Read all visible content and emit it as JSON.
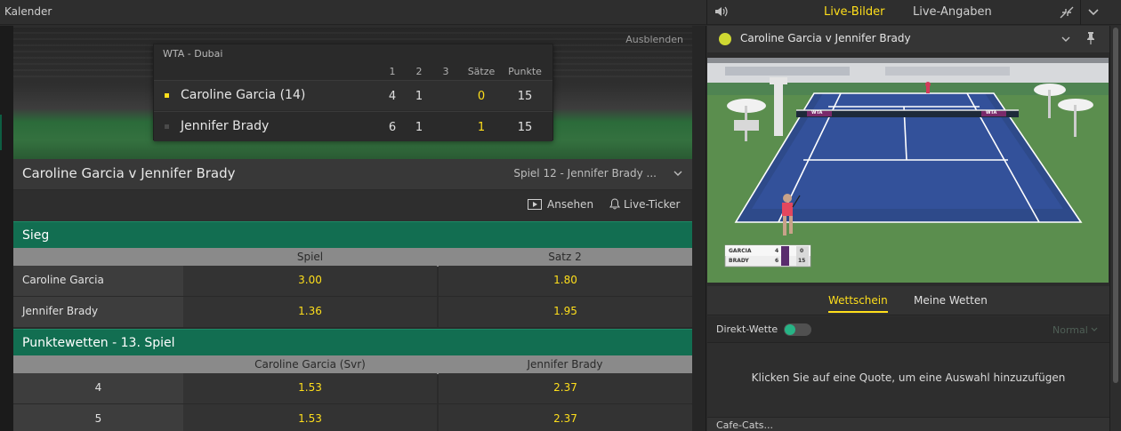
{
  "topbar": {
    "calendar": "Kalender",
    "tabs": [
      "Live-Bilder",
      "Live-Angaben"
    ]
  },
  "hero": {
    "hide_label": "Ausblenden",
    "scoreboard": {
      "tournament": "WTA - Dubai",
      "headers": [
        "1",
        "2",
        "3",
        "Sätze",
        "Punkte"
      ],
      "players": [
        {
          "name": "Caroline Garcia (14)",
          "set1": "4",
          "set2": "1",
          "set3": "",
          "sets": "0",
          "points": "15",
          "serving": true
        },
        {
          "name": "Jennifer Brady",
          "set1": "6",
          "set2": "1",
          "set3": "",
          "sets": "1",
          "points": "15",
          "serving": false
        }
      ]
    }
  },
  "match": {
    "title": "Caroline Garcia v Jennifer Brady",
    "game_status": "Spiel 12 - Jennifer Brady ...",
    "watch_label": "Ansehen",
    "ticker_label": "Live-Ticker"
  },
  "markets": [
    {
      "title": "Sieg",
      "columns": [
        "Spiel",
        "Satz 2"
      ],
      "rows": [
        {
          "label": "Caroline Garcia",
          "odds": [
            "3.00",
            "1.80"
          ]
        },
        {
          "label": "Jennifer Brady",
          "odds": [
            "1.36",
            "1.95"
          ]
        }
      ]
    },
    {
      "title": "Punktewetten - 13. Spiel",
      "columns": [
        "Caroline Garcia (Svr)",
        "Jennifer Brady"
      ],
      "rows": [
        {
          "label": "4",
          "odds": [
            "1.53",
            "2.37"
          ]
        },
        {
          "label": "5",
          "odds": [
            "1.53",
            "2.37"
          ]
        }
      ]
    }
  ],
  "video": {
    "title": "Caroline Garcia v Jennifer Brady",
    "overlay": {
      "p1": "GARCIA",
      "p1_games": "4",
      "p1_score": "0",
      "p2": "BRADY",
      "p2_games": "6",
      "p2_score": "15",
      "banner": "WTA"
    }
  },
  "betslip": {
    "tabs": [
      "Wettschein",
      "Meine Wetten"
    ],
    "direct_label": "Direkt-Wette",
    "mode": "Normal",
    "empty_message": "Klicken Sie auf eine Quote, um eine Auswahl hinzuzufügen",
    "bottom_label": "Cafe-Cats..."
  },
  "colors": {
    "accent": "#ffdf1b",
    "market_green": "#126e51",
    "toggle_green": "#27b385"
  }
}
